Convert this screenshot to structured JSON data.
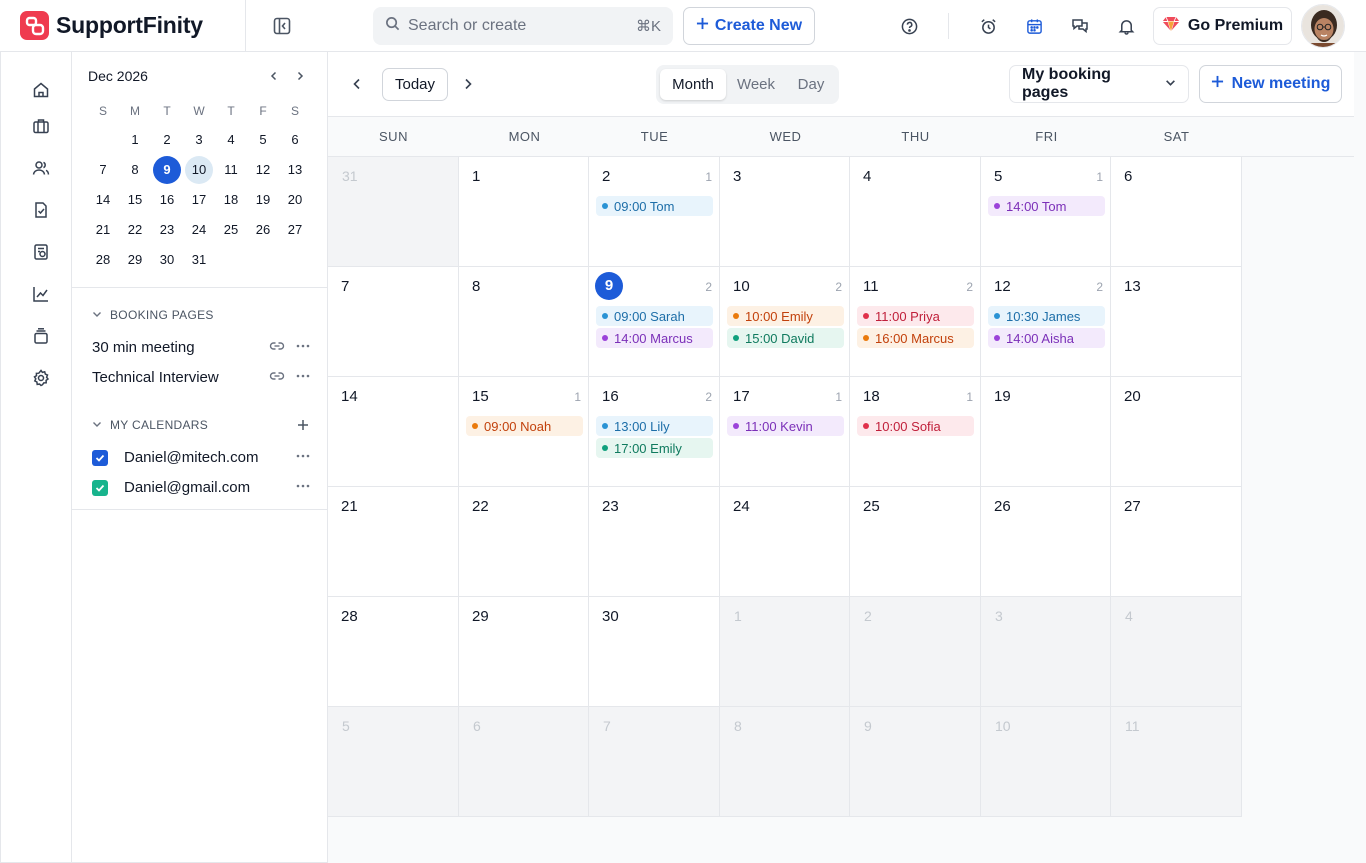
{
  "app": {
    "name": "SupportFinity"
  },
  "search": {
    "placeholder": "Search or create",
    "shortcut": "⌘K"
  },
  "header": {
    "create_label": "Create New",
    "premium_label": "Go Premium"
  },
  "rail": {
    "icons": [
      "home-icon",
      "briefcase-icon",
      "users-icon",
      "document-icon",
      "report-icon",
      "chart-icon",
      "inbox-icon",
      "settings-icon"
    ]
  },
  "mini_calendar": {
    "title": "Dec 2026",
    "dow": [
      "S",
      "M",
      "T",
      "W",
      "T",
      "F",
      "S"
    ],
    "weeks": [
      [
        "",
        "1",
        "2",
        "3",
        "4",
        "5",
        "6"
      ],
      [
        "7",
        "8",
        "9",
        "10",
        "11",
        "12",
        "13"
      ],
      [
        "14",
        "15",
        "16",
        "17",
        "18",
        "19",
        "20"
      ],
      [
        "21",
        "22",
        "23",
        "24",
        "25",
        "26",
        "27"
      ],
      [
        "28",
        "29",
        "30",
        "31",
        "",
        "",
        ""
      ]
    ],
    "today": "9",
    "highlighted": "10"
  },
  "booking_pages": {
    "heading": "BOOKING PAGES",
    "items": [
      {
        "label": "30 min meeting"
      },
      {
        "label": "Technical Interview"
      }
    ]
  },
  "my_calendars": {
    "heading": "MY CALENDARS",
    "items": [
      {
        "label": "Daniel@mitech.com",
        "color": "#1d5bd8"
      },
      {
        "label": "Daniel@gmail.com",
        "color": "#18b48d"
      }
    ]
  },
  "toolbar": {
    "today_label": "Today",
    "views": [
      "Month",
      "Week",
      "Day"
    ],
    "active_view": "Month",
    "booking_dropdown": "My booking pages",
    "new_meeting_label": "New meeting"
  },
  "colors": {
    "blue": {
      "dot": "#2b93d4",
      "bg": "#e8f4fc",
      "text": "#1d6ea8"
    },
    "purple": {
      "dot": "#9b42d9",
      "bg": "#f3eafc",
      "text": "#7b2fb8"
    },
    "orange": {
      "dot": "#ea7a0c",
      "bg": "#fdf1e4",
      "text": "#c2410c"
    },
    "green": {
      "dot": "#11a07d",
      "bg": "#e6f6f0",
      "text": "#0f7a5e"
    },
    "red": {
      "dot": "#e0314b",
      "bg": "#fde9ec",
      "text": "#c01f3a"
    }
  },
  "month_grid": {
    "weekday_headers": [
      "SUN",
      "MON",
      "TUE",
      "WED",
      "THU",
      "FRI",
      "SAT"
    ],
    "weeks": [
      [
        {
          "day": "31",
          "muted": true,
          "count": "",
          "events": []
        },
        {
          "day": "1",
          "count": "",
          "events": []
        },
        {
          "day": "2",
          "count": "1",
          "events": [
            {
              "label": "09:00 Tom",
              "color": "blue"
            }
          ]
        },
        {
          "day": "3",
          "count": "",
          "events": []
        },
        {
          "day": "4",
          "count": "",
          "events": []
        },
        {
          "day": "5",
          "count": "1",
          "events": [
            {
              "label": "14:00 Tom",
              "color": "purple"
            }
          ]
        },
        {
          "day": "6",
          "count": "",
          "events": []
        }
      ],
      [
        {
          "day": "7",
          "count": "",
          "events": []
        },
        {
          "day": "8",
          "count": "",
          "events": []
        },
        {
          "day": "9",
          "today": true,
          "count": "2",
          "events": [
            {
              "label": "09:00 Sarah",
              "color": "blue"
            },
            {
              "label": "14:00 Marcus",
              "color": "purple"
            }
          ]
        },
        {
          "day": "10",
          "count": "2",
          "events": [
            {
              "label": "10:00 Emily",
              "color": "orange"
            },
            {
              "label": "15:00 David",
              "color": "green"
            }
          ]
        },
        {
          "day": "11",
          "count": "2",
          "events": [
            {
              "label": "11:00 Priya",
              "color": "red"
            },
            {
              "label": "16:00 Marcus",
              "color": "orange"
            }
          ]
        },
        {
          "day": "12",
          "count": "2",
          "events": [
            {
              "label": "10:30 James",
              "color": "blue"
            },
            {
              "label": "14:00 Aisha",
              "color": "purple"
            }
          ]
        },
        {
          "day": "13",
          "count": "",
          "events": []
        }
      ],
      [
        {
          "day": "14",
          "count": "",
          "events": []
        },
        {
          "day": "15",
          "count": "1",
          "events": [
            {
              "label": "09:00 Noah",
              "color": "orange"
            }
          ]
        },
        {
          "day": "16",
          "count": "2",
          "events": [
            {
              "label": "13:00 Lily",
              "color": "blue"
            },
            {
              "label": "17:00 Emily",
              "color": "green"
            }
          ]
        },
        {
          "day": "17",
          "count": "1",
          "events": [
            {
              "label": "11:00 Kevin",
              "color": "purple"
            }
          ]
        },
        {
          "day": "18",
          "count": "1",
          "events": [
            {
              "label": "10:00 Sofia",
              "color": "red"
            }
          ]
        },
        {
          "day": "19",
          "count": "",
          "events": []
        },
        {
          "day": "20",
          "count": "",
          "events": []
        }
      ],
      [
        {
          "day": "21",
          "count": "",
          "events": []
        },
        {
          "day": "22",
          "count": "",
          "events": []
        },
        {
          "day": "23",
          "count": "",
          "events": []
        },
        {
          "day": "24",
          "count": "",
          "events": []
        },
        {
          "day": "25",
          "count": "",
          "events": []
        },
        {
          "day": "26",
          "count": "",
          "events": []
        },
        {
          "day": "27",
          "count": "",
          "events": []
        }
      ],
      [
        {
          "day": "28",
          "count": "",
          "events": []
        },
        {
          "day": "29",
          "count": "",
          "events": []
        },
        {
          "day": "30",
          "count": "",
          "events": []
        },
        {
          "day": "1",
          "muted": true,
          "count": "",
          "events": []
        },
        {
          "day": "2",
          "muted": true,
          "count": "",
          "events": []
        },
        {
          "day": "3",
          "muted": true,
          "count": "",
          "events": []
        },
        {
          "day": "4",
          "muted": true,
          "count": "",
          "events": []
        }
      ],
      [
        {
          "day": "5",
          "muted": true,
          "count": "",
          "events": []
        },
        {
          "day": "6",
          "muted": true,
          "count": "",
          "events": []
        },
        {
          "day": "7",
          "muted": true,
          "count": "",
          "events": []
        },
        {
          "day": "8",
          "muted": true,
          "count": "",
          "events": []
        },
        {
          "day": "9",
          "muted": true,
          "count": "",
          "events": []
        },
        {
          "day": "10",
          "muted": true,
          "count": "",
          "events": []
        },
        {
          "day": "11",
          "muted": true,
          "count": "",
          "events": []
        }
      ]
    ]
  }
}
